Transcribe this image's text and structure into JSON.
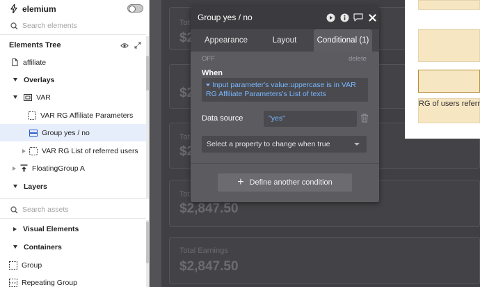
{
  "app": {
    "name": "elemium"
  },
  "left": {
    "search_elements_placeholder": "Search elements",
    "elements_tree_title": "Elements Tree",
    "items": {
      "affiliate": "affiliate",
      "overlays": "Overlays",
      "var": "VAR",
      "var_rg_affiliate": "VAR RG Affiliate Parameters",
      "group_yes_no": "Group yes / no",
      "var_rg_referred": "VAR RG List of referred users",
      "floating_group": "FloatingGroup A",
      "layers": "Layers"
    },
    "search_assets_placeholder": "Search assets",
    "visual_elements": "Visual Elements",
    "containers": "Containers",
    "group": "Group",
    "repeating_group": "Repeating Group"
  },
  "canvas": {
    "cards": [
      {
        "label": "Tot",
        "value": "$2"
      },
      {
        "label": "",
        "value": "$2"
      },
      {
        "label": "Tot",
        "value": "$2"
      },
      {
        "label": "Tot",
        "value": "$2,847.50"
      },
      {
        "label": "Total Earnings",
        "value": "$2,847.50"
      }
    ],
    "beige_text": "RG of users referr"
  },
  "popup": {
    "title": "Group yes / no",
    "tabs": [
      "Appearance",
      "Layout",
      "Conditional (1)"
    ],
    "off": "OFF",
    "delete": "delete",
    "when_label": "When",
    "expression": "Input parameter's value:uppercase is in VAR RG Affiliate Parameters's List of texts",
    "data_source_label": "Data source",
    "data_source_value": "\"yes\"",
    "select_property": "Select a property to change when true",
    "define_button": "Define another condition"
  }
}
